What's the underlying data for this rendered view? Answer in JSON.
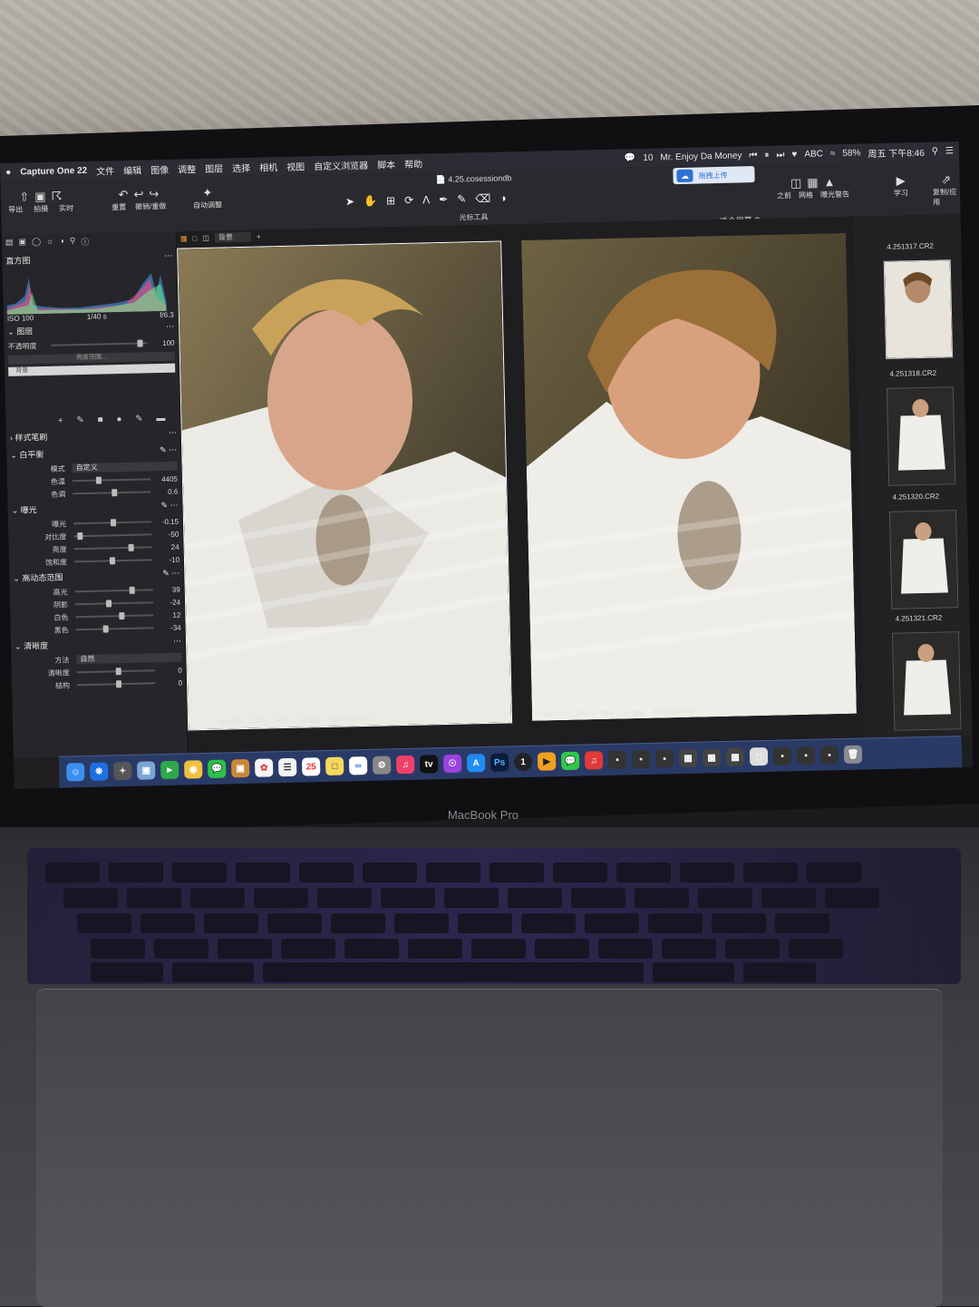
{
  "menubar": {
    "app_name": "Capture One 22",
    "menus": [
      "文件",
      "编辑",
      "图像",
      "调整",
      "图层",
      "选择",
      "相机",
      "视图",
      "自定义浏览器",
      "脚本",
      "帮助"
    ],
    "chat_count": "10",
    "now_playing": "Mr. Enjoy Da Money",
    "battery": "58%",
    "clock": "周五 下午8:46",
    "input_method": "ABC"
  },
  "toolbar": {
    "document_title": "4.25.cosessiondb",
    "upload_label": "拖拽上传",
    "left_labels": [
      "导出",
      "拍摄",
      "实时"
    ],
    "undo_labels": [
      "重置",
      "撤销/重做"
    ],
    "auto_adjust": "自动调整",
    "cursor_tools": "光标工具",
    "right_labels": [
      "之前",
      "网格",
      "曝光警告",
      "学习",
      "复制/应用"
    ],
    "fit_screen": "适合屏幕"
  },
  "left_panel": {
    "histogram_title": "直方图",
    "histogram_info": {
      "iso": "ISO 100",
      "shutter": "1/40 s",
      "aperture": "f/6.3"
    },
    "layers_title": "图层",
    "opacity_label": "不透明度",
    "opacity_value": "100",
    "luma_range": "亮度范围...",
    "background_layer": "背景",
    "style_brush": "样式笔刷",
    "white_balance": {
      "title": "白平衡",
      "mode_label": "模式",
      "mode_value": "自定义",
      "rows": [
        {
          "label": "色温",
          "value": "4405",
          "pos": 0.3
        },
        {
          "label": "色调",
          "value": "0.6",
          "pos": 0.5
        }
      ]
    },
    "exposure": {
      "title": "曝光",
      "rows": [
        {
          "label": "曝光",
          "value": "-0.15",
          "pos": 0.48
        },
        {
          "label": "对比度",
          "value": "-50",
          "pos": 0.05
        },
        {
          "label": "亮度",
          "value": "24",
          "pos": 0.7
        },
        {
          "label": "饱和度",
          "value": "-10",
          "pos": 0.45
        }
      ]
    },
    "hdr": {
      "title": "高动态范围",
      "rows": [
        {
          "label": "高光",
          "value": "39",
          "pos": 0.7
        },
        {
          "label": "阴影",
          "value": "-24",
          "pos": 0.4
        },
        {
          "label": "白色",
          "value": "12",
          "pos": 0.56
        },
        {
          "label": "黑色",
          "value": "-34",
          "pos": 0.35
        }
      ]
    },
    "clarity": {
      "title": "清晰度",
      "method_label": "方法",
      "method_value": "自然",
      "rows": [
        {
          "label": "清晰度",
          "value": "0",
          "pos": 0.5
        },
        {
          "label": "结构",
          "value": "0",
          "pos": 0.5
        }
      ]
    }
  },
  "viewer": {
    "layer_select": "背景",
    "left_photo": {
      "iso": "ISO 100",
      "shutter": "1/40 s",
      "aperture": "f/6.3",
      "focal": "73 毫米",
      "file": "4.251315.CR2"
    },
    "right_photo": {
      "iso": "ISO 100",
      "shutter": "1/40 s",
      "aperture": "f/6.3",
      "focal": "70 毫米",
      "file": "4.251318.CR2"
    }
  },
  "filmstrip": {
    "items": [
      "4.251317.CR2",
      "4.251318.CR2",
      "4.251320.CR2",
      "4.251321.CR2"
    ]
  },
  "dock": {
    "calendar_day": "25",
    "ps_label": "Ps",
    "tv_label": "tv"
  },
  "device": {
    "brand": "MacBook Pro"
  },
  "colors": {
    "menubar_bg": "#2b2c34",
    "panel_bg": "#26262a",
    "dock_bg": "#2a3a66",
    "accent_blue": "#2f6fd4"
  }
}
